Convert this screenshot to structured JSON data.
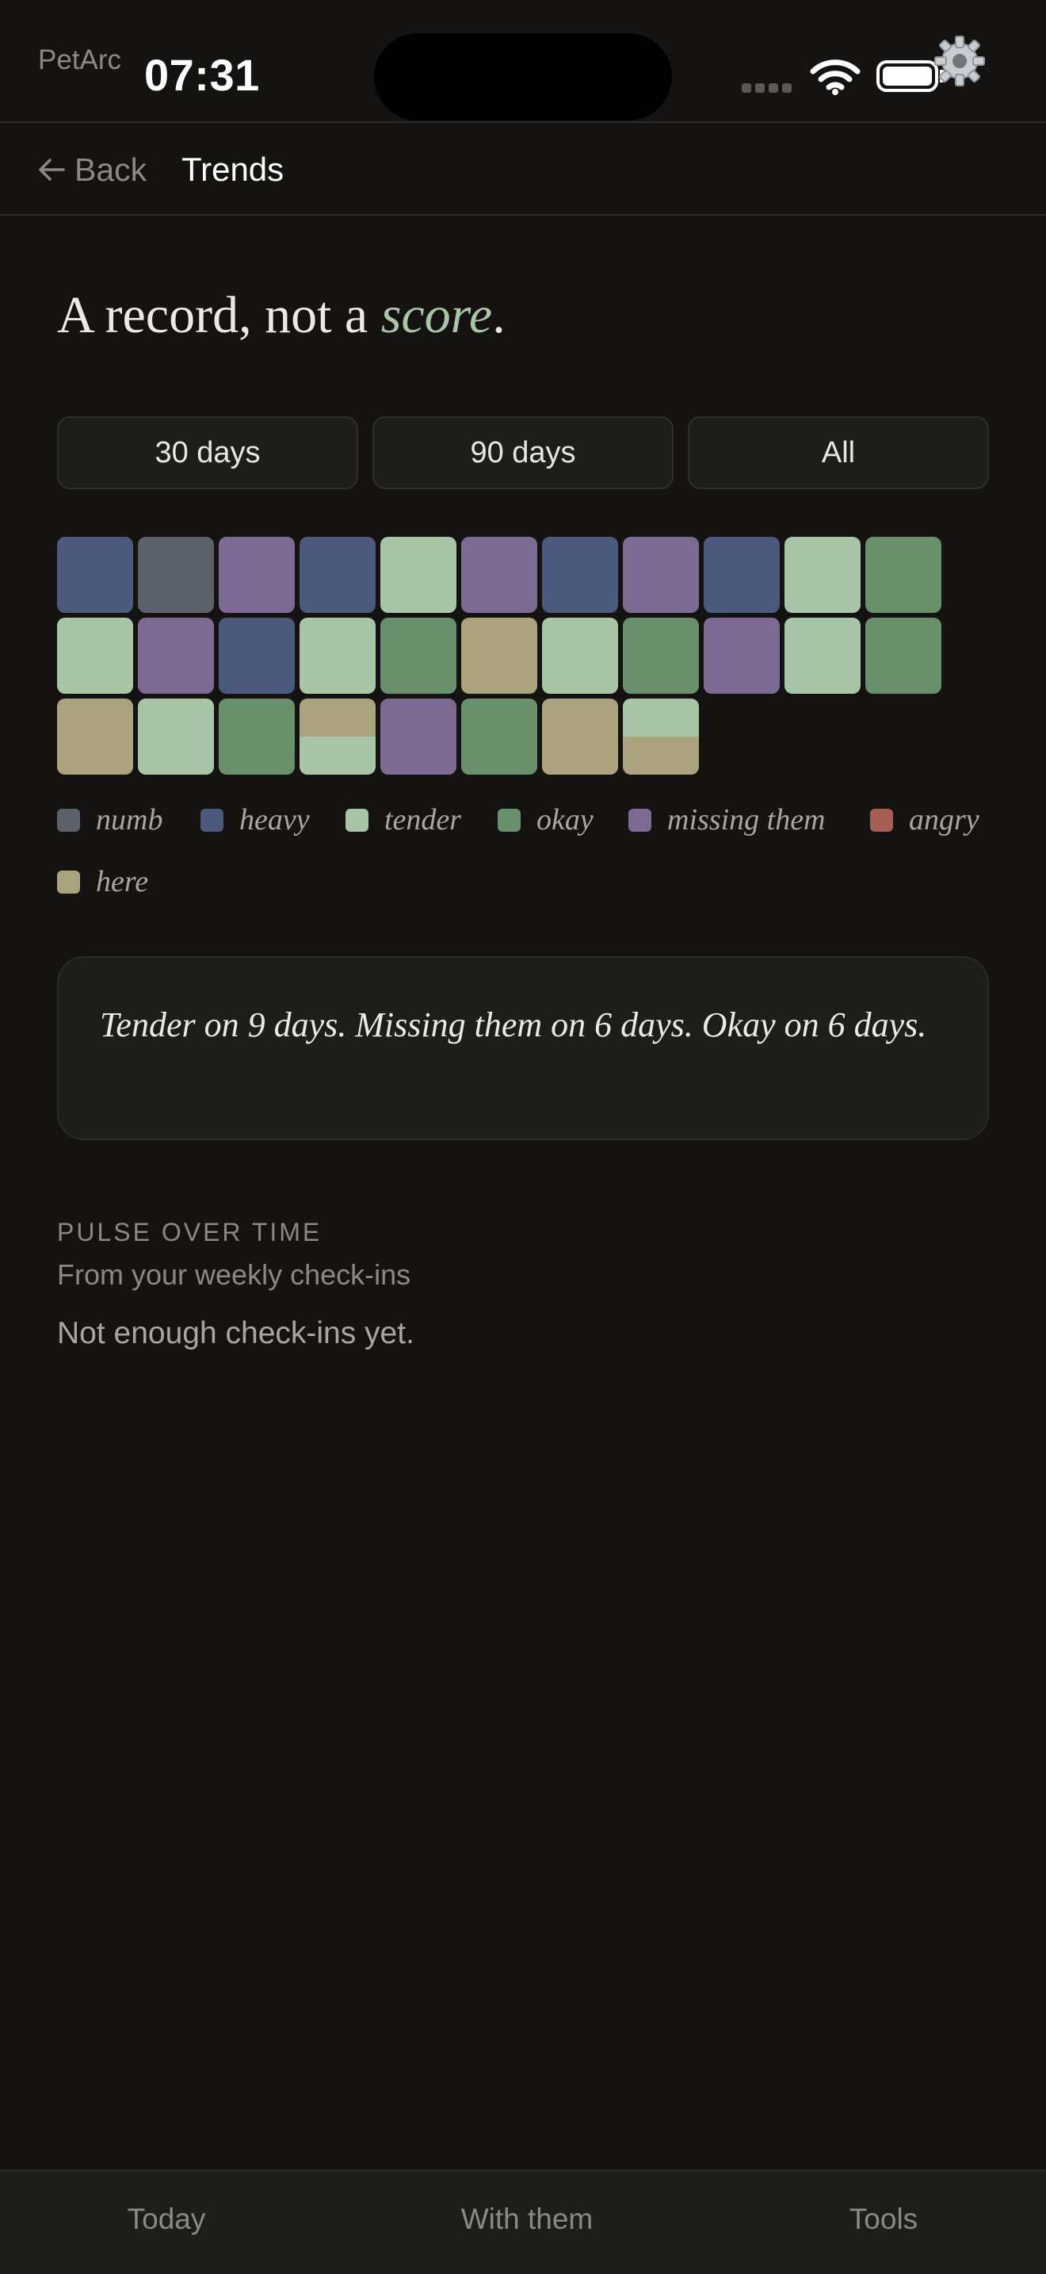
{
  "status_bar": {
    "app_name": "PetArc",
    "time": "07:31"
  },
  "nav": {
    "back_label": "Back",
    "title": "Trends"
  },
  "headline": {
    "text": "A record, not a ",
    "emphasis": "score",
    "end": "."
  },
  "range_tabs": [
    {
      "label": "30 days",
      "selected": true
    },
    {
      "label": "90 days",
      "selected": false
    },
    {
      "label": "All",
      "selected": false
    }
  ],
  "moods": {
    "numb": "#5c6068",
    "heavy": "#4b5a7c",
    "tender": "#a9c5a7",
    "okay": "#6a8f6d",
    "missing": "#7d6a93",
    "angry": "#a35f52",
    "here": "#aba37e"
  },
  "calendar_days": [
    [
      "heavy"
    ],
    [
      "numb"
    ],
    [
      "missing"
    ],
    [
      "heavy"
    ],
    [
      "tender"
    ],
    [
      "missing"
    ],
    [
      "heavy"
    ],
    [
      "missing"
    ],
    [
      "heavy"
    ],
    [
      "tender"
    ],
    [
      "okay"
    ],
    [
      "tender"
    ],
    [
      "missing"
    ],
    [
      "heavy"
    ],
    [
      "tender"
    ],
    [
      "okay"
    ],
    [
      "here"
    ],
    [
      "tender"
    ],
    [
      "okay"
    ],
    [
      "missing"
    ],
    [
      "tender"
    ],
    [
      "okay"
    ],
    [
      "here"
    ],
    [
      "tender"
    ],
    [
      "okay"
    ],
    [
      "here",
      "tender"
    ],
    [
      "missing"
    ],
    [
      "okay"
    ],
    [
      "here"
    ],
    [
      "tender",
      "here"
    ]
  ],
  "legend": [
    {
      "label": "numb",
      "color": "#5c6068"
    },
    {
      "label": "heavy",
      "color": "#4b5a7c"
    },
    {
      "label": "tender",
      "color": "#a9c5a7"
    },
    {
      "label": "okay",
      "color": "#6a8f6d"
    },
    {
      "label": "missing them",
      "color": "#7d6a93"
    },
    {
      "label": "angry",
      "color": "#a35f52"
    },
    {
      "label": "here",
      "color": "#aba37e"
    }
  ],
  "summary": "Tender on 9 days. Missing them on 6 days. Okay on 6 days.",
  "pulse": {
    "label": "PULSE OVER TIME",
    "subtitle": "From your weekly check-ins",
    "empty_text": "Not enough check-ins yet."
  },
  "tabbar": [
    {
      "label": "Today"
    },
    {
      "label": "With them"
    },
    {
      "label": "Tools"
    }
  ]
}
